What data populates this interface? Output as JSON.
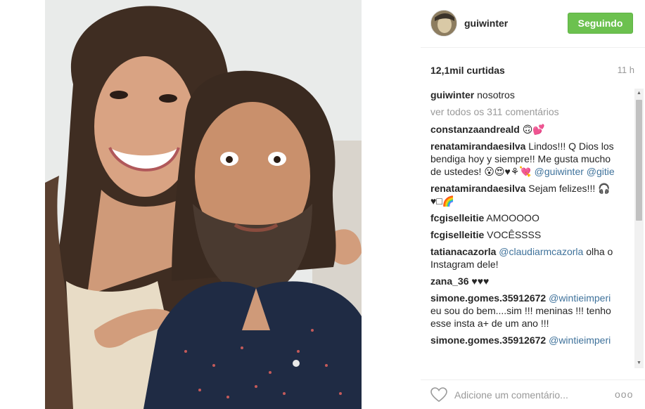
{
  "header": {
    "username": "guiwinter",
    "follow_label": "Seguindo"
  },
  "stats": {
    "likes": "12,1mil curtidas",
    "time": "11 h"
  },
  "caption": {
    "user": "guiwinter",
    "text": "nosotros"
  },
  "view_all": "ver todos os 311 comentários",
  "comments": [
    {
      "user": "constanzaandreald",
      "text": "🙃💕"
    },
    {
      "user": "renatamirandaesilva",
      "text": "Lindos!!! Q Dios los bendiga hoy y siempre!! Me gusta mucho de ustedes! 😮😍♥⚘💘",
      "mentions": [
        "@guiwinter",
        "@gitie"
      ]
    },
    {
      "user": "renatamirandaesilva",
      "text": "Sejam felizes!!! 🎧♥□🌈"
    },
    {
      "user": "fcgiselleitie",
      "text": "AMOOOOO"
    },
    {
      "user": "fcgiselleitie",
      "text": "VOCÊSSSS"
    },
    {
      "user": "tatianacazorla",
      "mention": "@claudiarmcazorla",
      "text": "olha o Instagram dele!"
    },
    {
      "user": "zana_36",
      "text": "♥♥♥"
    },
    {
      "user": "simone.gomes.35912672",
      "mention": "@wintieimperi",
      "text": "eu sou do bem....sim !!! meninas !!! tenho esse insta a+ de um ano !!!"
    },
    {
      "user": "simone.gomes.35912672",
      "mention": "@wintieimperi",
      "text": ""
    }
  ],
  "footer": {
    "comment_placeholder": "Adicione um comentário...",
    "more": "ooo"
  }
}
